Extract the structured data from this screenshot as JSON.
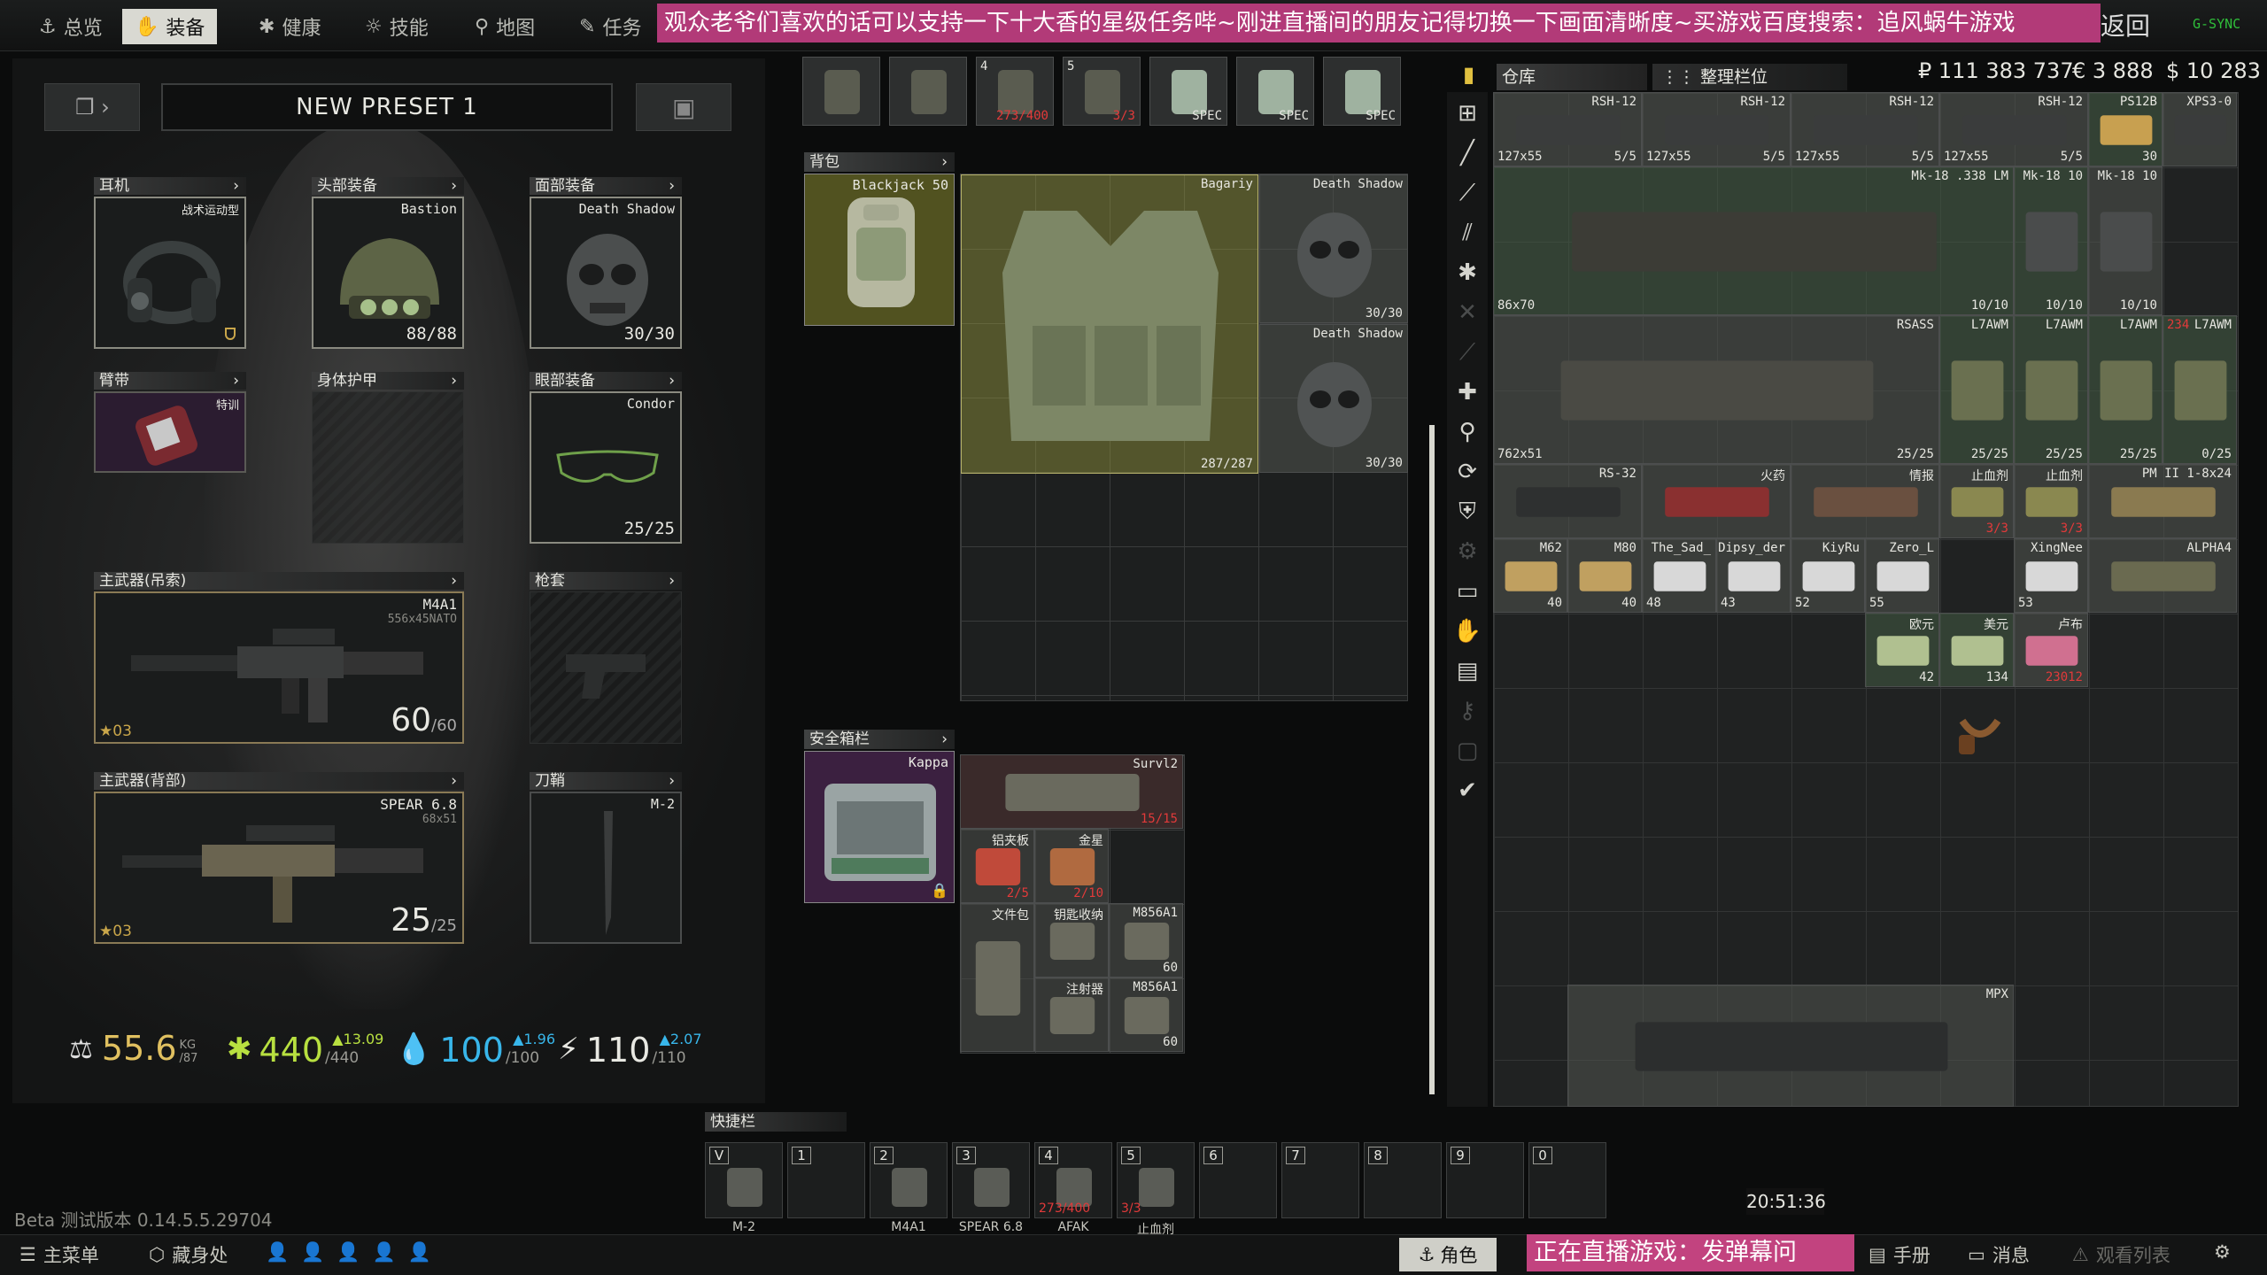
{
  "nav": {
    "tabs": [
      "总览",
      "装备",
      "健康",
      "技能",
      "地图",
      "任务"
    ],
    "active": "装备",
    "banner": "观众老爷们喜欢的话可以支持一下十大香的星级任务哔~刚进直播间的朋友记得切换一下画面清晰度~买游戏百度搜索：追风蜗牛游戏",
    "banner_tail": "返回",
    "gsync": "G-SYNC"
  },
  "preset": {
    "name": "NEW PRESET 1"
  },
  "slots": {
    "headphones": {
      "label": "耳机",
      "item": "战术运动型"
    },
    "headwear": {
      "label": "头部装备",
      "item": "Bastion",
      "durability": "88/88"
    },
    "faceCover": {
      "label": "面部装备",
      "item": "Death Shadow",
      "durability": "30/30"
    },
    "armband": {
      "label": "臂带",
      "item": "特训"
    },
    "bodyArmor": {
      "label": "身体护甲"
    },
    "eyewear": {
      "label": "眼部装备",
      "item": "Condor",
      "durability": "25/25"
    },
    "primarySling": {
      "label": "主武器(吊索)",
      "item": "M4A1",
      "caliber": "556x45NATO",
      "ammo": "60",
      "ammoMax": "/60",
      "level": "03"
    },
    "holster": {
      "label": "枪套"
    },
    "primaryBack": {
      "label": "主武器(背部)",
      "item": "SPEAR 6.8",
      "caliber": "68x51",
      "ammo": "25",
      "ammoMax": "/25",
      "level": "03"
    },
    "scabbard": {
      "label": "刀鞘",
      "item": "M-2"
    }
  },
  "stats": {
    "weight": {
      "value": "55.6",
      "unit": "KG",
      "max": "/87"
    },
    "health": {
      "value": "440",
      "max": "/440",
      "delta": "▲13.09"
    },
    "hydration": {
      "value": "100",
      "max": "/100",
      "delta": "▲1.96"
    },
    "energy": {
      "value": "110",
      "max": "/110",
      "delta": "▲2.07"
    }
  },
  "gear": {
    "backpack": {
      "label": "背包",
      "item": "Blackjack 50"
    },
    "vest": {
      "item": "Bagariy",
      "durability": "287/287"
    },
    "vestPocket1": {
      "item": "Death Shadow",
      "durability": "30/30"
    },
    "vestPocket2": {
      "item": "Death Shadow",
      "durability": "30/30"
    },
    "topItems": [
      {
        "cnt": ""
      },
      {
        "cnt": ""
      },
      {
        "cnt": "273/400",
        "red": true,
        "n": "4"
      },
      {
        "cnt": "3/3",
        "red": true,
        "n": "5"
      },
      {
        "cnt": "SPEC"
      },
      {
        "cnt": "SPEC"
      },
      {
        "cnt": "SPEC"
      }
    ],
    "secure": {
      "label": "安全箱栏",
      "item": "Kappa"
    },
    "secureItems": [
      {
        "name": "Survl2",
        "cnt": "15/15"
      },
      {
        "name": "铝夹板",
        "cnt": "2/5"
      },
      {
        "name": "金星",
        "cnt": "2/10"
      },
      {
        "name": "文件包",
        "cnt": ""
      },
      {
        "name": "钥匙收纳",
        "cnt": ""
      },
      {
        "name": "M856A1",
        "cnt": "60"
      },
      {
        "name": "注射器",
        "cnt": ""
      },
      {
        "name": "M856A1",
        "cnt": "60"
      }
    ]
  },
  "stash": {
    "title": "仓库",
    "sortLabel": "整理栏位",
    "roubles": "₽ 111 383 737",
    "euros": "€ 3 888",
    "dollars": "$ 10 283",
    "row1": [
      {
        "name": "RSH-12",
        "cntl": "127x55",
        "cnt": "5/5"
      },
      {
        "name": "RSH-12",
        "cntl": "127x55",
        "cnt": "5/5"
      },
      {
        "name": "RSH-12",
        "cntl": "127x55",
        "cnt": "5/5"
      },
      {
        "name": "RSH-12",
        "cntl": "127x55",
        "cnt": "5/5"
      },
      {
        "name": "PS12B",
        "cnt": "30"
      },
      {
        "name": "XPS3-0",
        "cnt": ""
      }
    ],
    "rifle1": {
      "name": "Mk-18 .338 LM",
      "cntl": "86x70",
      "cnt": "10/10"
    },
    "mags1": [
      {
        "name": "Mk-18 10",
        "cnt": "10/10"
      },
      {
        "name": "Mk-18 10",
        "cnt": "10/10"
      }
    ],
    "rifle2": {
      "name": "RSASS",
      "cntl": "762x51",
      "cnt": "25/25"
    },
    "mags2": [
      {
        "name": "L7AWM",
        "cnt": "25/25"
      },
      {
        "name": "L7AWM",
        "cnt": "25/25"
      },
      {
        "name": "L7AWM",
        "cnt": "25/25"
      },
      {
        "name": "L7AWM",
        "cnt": "0/25",
        "tag": "234"
      }
    ],
    "row4": [
      {
        "name": "RS-32",
        "cnt": ""
      },
      {
        "name": "火药",
        "cnt": ""
      },
      {
        "name": "情报",
        "cnt": ""
      },
      {
        "name": "止血剂",
        "cnt": "3/3"
      },
      {
        "name": "止血剂",
        "cnt": "3/3"
      },
      {
        "name": "PM II 1-8x24",
        "cnt": ""
      }
    ],
    "row5": [
      {
        "name": "M62",
        "cnt": "40"
      },
      {
        "name": "M80",
        "cnt": "40"
      },
      {
        "name": "The_Sad_",
        "cntl": "48"
      },
      {
        "name": "Dipsy_der",
        "cntl": "43"
      },
      {
        "name": "KiyRu",
        "cntl": "52"
      },
      {
        "name": "Zero_L",
        "cntl": "55"
      },
      {
        "name": "XingNee",
        "cntl": "53"
      },
      {
        "name": "ALPHA4",
        "cnt": ""
      }
    ],
    "row6": [
      {
        "name": "欧元",
        "cnt": "42"
      },
      {
        "name": "美元",
        "cnt": "134"
      },
      {
        "name": "卢布",
        "cnt": "23012"
      }
    ],
    "smg": {
      "name": "MPX"
    }
  },
  "quickbar": {
    "label": "快捷栏",
    "slots": [
      {
        "key": "V",
        "label": "M-2"
      },
      {
        "key": "1",
        "label": ""
      },
      {
        "key": "2",
        "label": "M4A1"
      },
      {
        "key": "3",
        "label": "SPEAR 6.8"
      },
      {
        "key": "4",
        "label": "AFAK",
        "cnt": "273/400"
      },
      {
        "key": "5",
        "label": "止血剂",
        "cnt": "3/3"
      },
      {
        "key": "6",
        "label": ""
      },
      {
        "key": "7",
        "label": ""
      },
      {
        "key": "8",
        "label": ""
      },
      {
        "key": "9",
        "label": ""
      },
      {
        "key": "0",
        "label": ""
      }
    ]
  },
  "footer": {
    "version": "Beta 测试版本 0.14.5.5.29704",
    "clock": "20:51:36",
    "mainMenu": "主菜单",
    "hideout": "藏身处",
    "character": "角色",
    "live": "正在直播游戏：发弹幕问",
    "manual": "手册",
    "messages": "消息",
    "watchlist": "观看列表"
  }
}
